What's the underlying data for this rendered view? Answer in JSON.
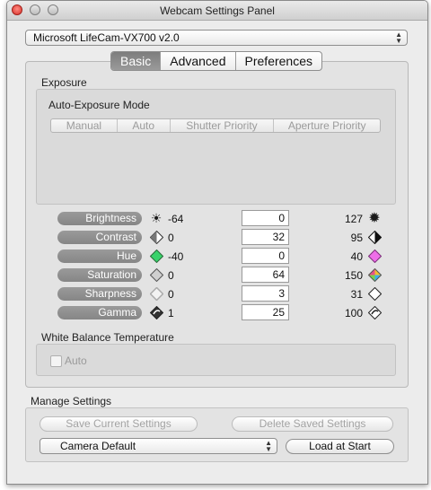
{
  "window": {
    "title": "Webcam Settings Panel"
  },
  "camera_select": {
    "value": "Microsoft LifeCam-VX700  v2.0"
  },
  "tabs": [
    {
      "label": "Basic",
      "selected": true
    },
    {
      "label": "Advanced",
      "selected": false
    },
    {
      "label": "Preferences",
      "selected": false
    }
  ],
  "exposure": {
    "section_label": "Exposure",
    "mode_label": "Auto-Exposure Mode",
    "modes": [
      "Manual",
      "Auto",
      "Shutter Priority",
      "Aperture Priority"
    ]
  },
  "controls": [
    {
      "label": "Brightness",
      "min": "-64",
      "value": "0",
      "max": "127",
      "icon": "sun-icon"
    },
    {
      "label": "Contrast",
      "min": "0",
      "value": "32",
      "max": "95",
      "icon": "contrast-icon"
    },
    {
      "label": "Hue",
      "min": "-40",
      "value": "0",
      "max": "40",
      "icon": "hue-icon"
    },
    {
      "label": "Saturation",
      "min": "0",
      "value": "64",
      "max": "150",
      "icon": "saturation-icon"
    },
    {
      "label": "Sharpness",
      "min": "0",
      "value": "3",
      "max": "31",
      "icon": "sharpness-icon"
    },
    {
      "label": "Gamma",
      "min": "1",
      "value": "25",
      "max": "100",
      "icon": "gamma-icon"
    }
  ],
  "white_balance": {
    "section_label": "White Balance Temperature",
    "auto_label": "Auto"
  },
  "manage": {
    "section_label": "Manage Settings",
    "save_label": "Save Current Settings",
    "delete_label": "Delete Saved Settings",
    "preset_value": "Camera Default",
    "load_label": "Load at Start"
  },
  "colors": {
    "hue_green": "#39d26a",
    "hue_pink": "#ee6ee8"
  }
}
